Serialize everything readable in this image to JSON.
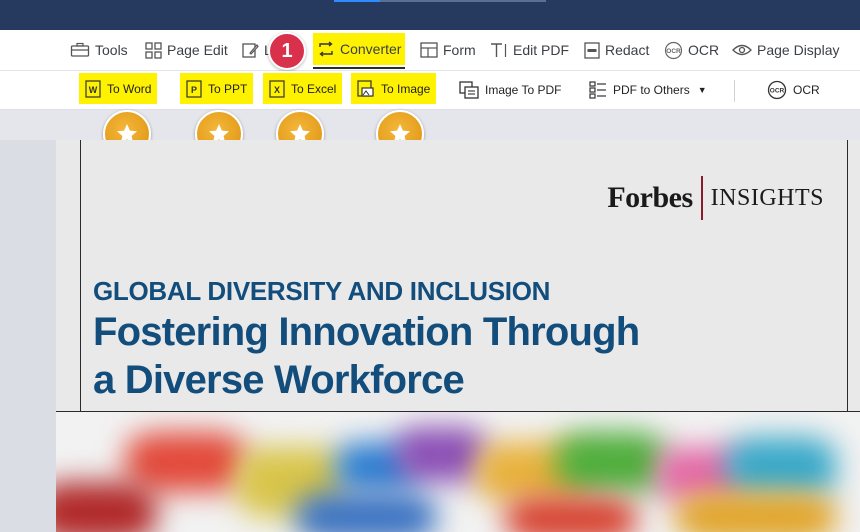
{
  "menu": {
    "items": [
      {
        "label": "Tools"
      },
      {
        "label": "Page Edit"
      },
      {
        "label": "L"
      },
      {
        "label": "Converter"
      },
      {
        "label": "Form"
      },
      {
        "label": "Edit PDF"
      },
      {
        "label": "Redact"
      },
      {
        "label": "OCR"
      },
      {
        "label": "Page Display"
      }
    ],
    "step_badge": "1"
  },
  "ribbon": {
    "to_word": "To Word",
    "to_ppt": "To PPT",
    "to_excel": "To Excel",
    "to_image": "To Image",
    "image_to_pdf": "Image To PDF",
    "pdf_to_others": "PDF to Others",
    "ocr": "OCR"
  },
  "document": {
    "brand_main": "Forbes",
    "brand_sub": "INSIGHTS",
    "kicker": "GLOBAL DIVERSITY AND INCLUSION",
    "headline_line1": "Fostering Innovation Through",
    "headline_line2": "a Diverse Workforce"
  },
  "colors": {
    "highlight": "#fff200",
    "title_bar": "#253a5e",
    "headline": "#124d7c",
    "badge": "#d9304c",
    "star": "#e9a126"
  },
  "icons": {
    "tools": "toolbox-icon",
    "page_edit": "grid-icon",
    "converter": "convert-arrows-icon",
    "form": "form-icon",
    "edit_pdf": "text-cursor-icon",
    "redact": "redact-icon",
    "ocr": "ocr-icon",
    "page_display": "eye-icon",
    "star": "star-icon"
  }
}
